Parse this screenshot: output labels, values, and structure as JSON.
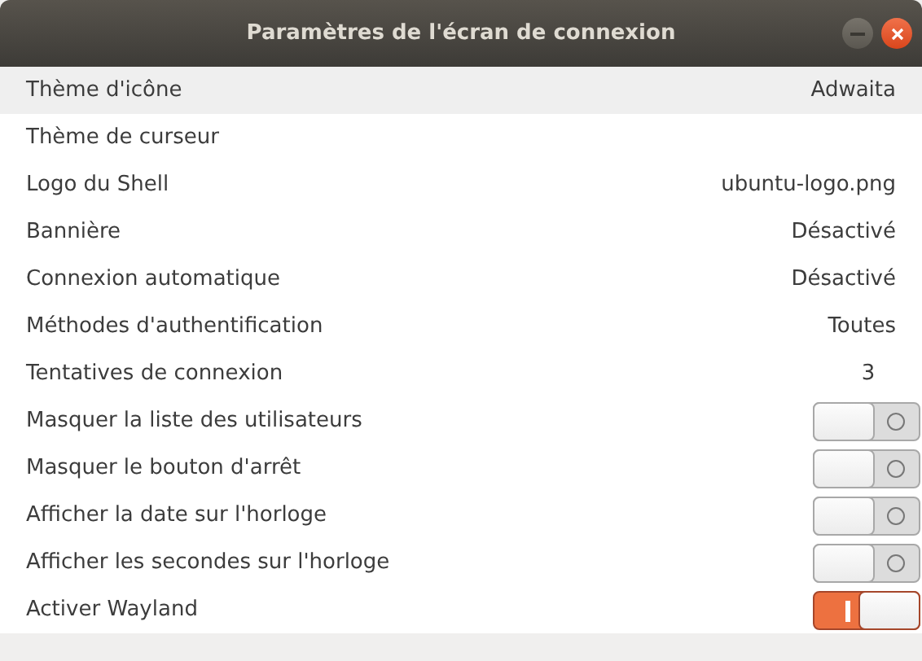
{
  "window": {
    "title": "Paramètres de l'écran de connexion"
  },
  "rows": [
    {
      "kind": "value",
      "label": "Thème d'icône",
      "value": "Adwaita",
      "selected": true
    },
    {
      "kind": "value",
      "label": "Thème de curseur",
      "selected": false
    },
    {
      "kind": "value",
      "label": "Logo du Shell",
      "value": "ubuntu-logo.png",
      "selected": false
    },
    {
      "kind": "value",
      "label": "Bannière",
      "value": "Désactivé",
      "selected": false
    },
    {
      "kind": "value",
      "label": "Connexion automatique",
      "value": "Désactivé",
      "selected": false
    },
    {
      "kind": "value",
      "label": "Méthodes d'authentification",
      "value": "Toutes",
      "selected": false
    },
    {
      "kind": "number",
      "label": "Tentatives de connexion",
      "value": "3",
      "selected": false
    },
    {
      "kind": "switch",
      "label": "Masquer la liste des utilisateurs",
      "on": false,
      "selected": false
    },
    {
      "kind": "switch",
      "label": "Masquer le bouton d'arrêt",
      "on": false,
      "selected": false
    },
    {
      "kind": "switch",
      "label": "Afficher la date sur l'horloge",
      "on": false,
      "selected": false
    },
    {
      "kind": "switch",
      "label": "Afficher les secondes sur l'horloge",
      "on": false,
      "selected": false
    },
    {
      "kind": "switch",
      "label": "Activer Wayland",
      "on": true,
      "selected": false
    }
  ]
}
